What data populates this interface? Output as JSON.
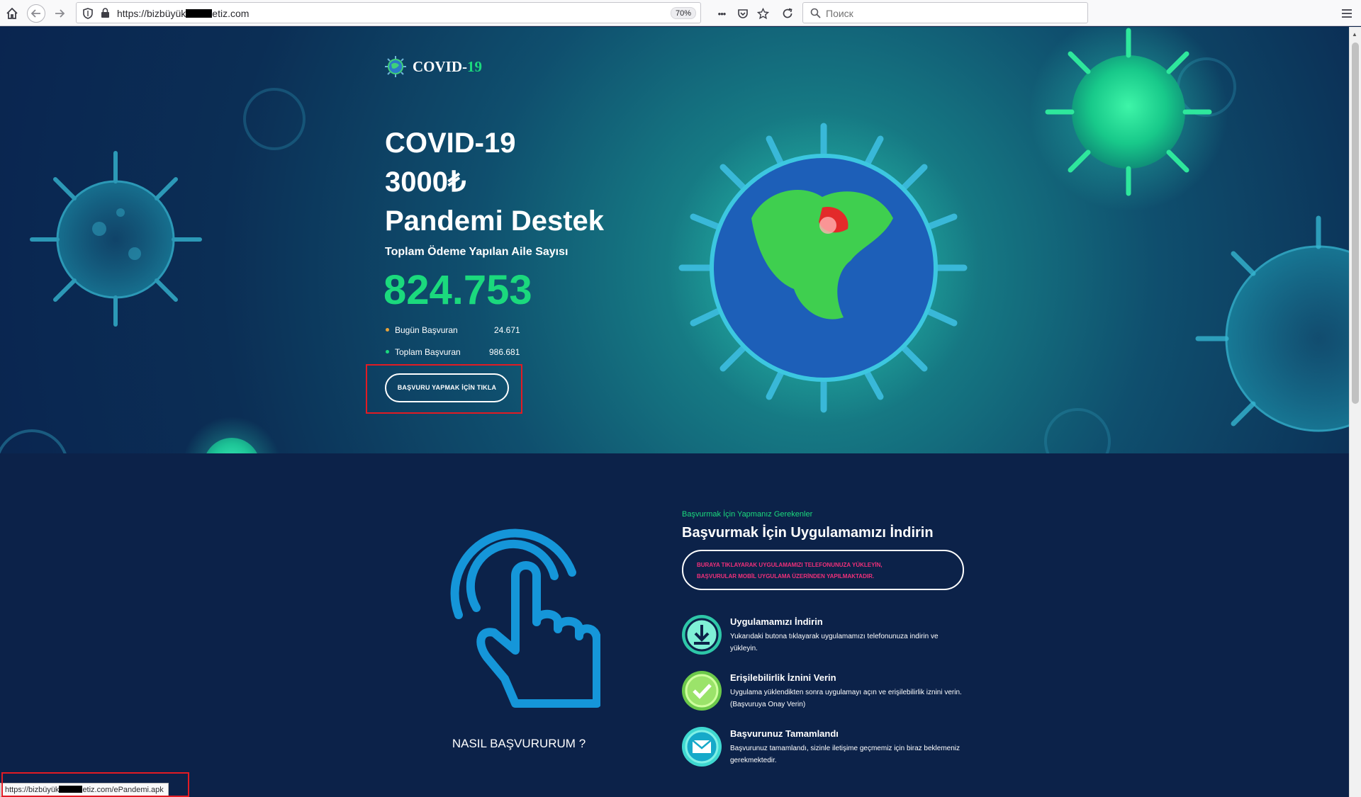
{
  "browser": {
    "url_prefix": "https://bizbüyük",
    "url_suffix": "etiz.com",
    "zoom": "70%",
    "search_placeholder": "Поиск",
    "menu_dots": "•••",
    "status_prefix": "https://bizbüyük",
    "status_suffix": "etiz.com/ePandemi.apk"
  },
  "brand": {
    "name": "COVID-",
    "accent": "19"
  },
  "hero": {
    "line1": "COVID-19",
    "line2": "3000₺",
    "line3": "Pandemi Destek",
    "subtitle": "Toplam Ödeme Yapılan Aile Sayısı",
    "big_number": "824.753",
    "stats": [
      {
        "label": "Bugün Başvuran",
        "value": "24.671",
        "dot_color": "#e8a33a"
      },
      {
        "label": "Toplam Başvuran",
        "value": "986.681",
        "dot_color": "#1bd97d"
      }
    ],
    "cta_label": "BAŞVURU YAPMAK İÇİN TIKLA"
  },
  "how": {
    "label": "NASIL BAŞVURURUM ?",
    "kicker": "Başvurmak İçin Yapmanız Gerekenler",
    "title": "Başvurmak İçin Uygulamamızı İndirin",
    "notice_line1": "BURAYA TIKLAYARAK UYGULAMAMIZI TELEFONUNUZA YÜKLEYİN,",
    "notice_line2": "BAŞVURULAR MOBİL UYGULAMA ÜZERİNDEN YAPILMAKTADIR."
  },
  "steps": [
    {
      "title": "Uygulamamızı İndirin",
      "desc": "Yukarıdaki butona tıklayarak uygulamamızı telefonunuza indirin ve yükleyin.",
      "icon": "download-icon"
    },
    {
      "title": "Erişilebilirlik İznini Verin",
      "desc": "Uygulama yüklendikten sonra uygulamayı açın ve erişilebilirlik iznini verin. (Başvuruya Onay Verin)",
      "icon": "check-icon"
    },
    {
      "title": "Başvurunuz Tamamlandı",
      "desc": "Başvurunuz tamamlandı, sizinle iletişime geçmemiz için biraz beklemeniz gerekmektedir.",
      "icon": "mail-icon"
    }
  ],
  "colors": {
    "accent_green": "#1bd97d",
    "notice_pink": "#f0307a",
    "highlight_red": "#e21b23",
    "page_bg": "#0c2249"
  }
}
